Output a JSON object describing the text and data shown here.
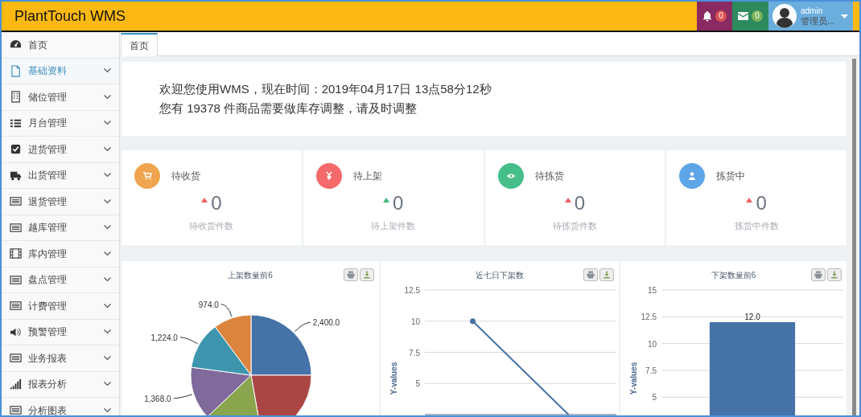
{
  "header": {
    "title": "PlantTouch WMS",
    "notifications": {
      "count": "0"
    },
    "messages": {
      "count": "0"
    },
    "user": {
      "name": "admin",
      "role": "管理员..."
    }
  },
  "sidebar": {
    "items": [
      {
        "label": "首页",
        "selected": false,
        "expandable": false
      },
      {
        "label": "基础资料",
        "selected": true,
        "expandable": true
      },
      {
        "label": "储位管理",
        "selected": false,
        "expandable": true
      },
      {
        "label": "月台管理",
        "selected": false,
        "expandable": true
      },
      {
        "label": "进货管理",
        "selected": false,
        "expandable": true
      },
      {
        "label": "出货管理",
        "selected": false,
        "expandable": true
      },
      {
        "label": "退货管理",
        "selected": false,
        "expandable": true
      },
      {
        "label": "越库管理",
        "selected": false,
        "expandable": true
      },
      {
        "label": "库内管理",
        "selected": false,
        "expandable": true
      },
      {
        "label": "盘点管理",
        "selected": false,
        "expandable": true
      },
      {
        "label": "计费管理",
        "selected": false,
        "expandable": true
      },
      {
        "label": "预警管理",
        "selected": false,
        "expandable": true
      },
      {
        "label": "业务报表",
        "selected": false,
        "expandable": true
      },
      {
        "label": "报表分析",
        "selected": false,
        "expandable": true
      },
      {
        "label": "分析图表",
        "selected": false,
        "expandable": true
      }
    ]
  },
  "tabs": [
    {
      "label": "首页",
      "selected": true
    }
  ],
  "welcome": {
    "lines": [
      "欢迎您使用WMS，现在时间：2019年04月17日 13点58分12秒",
      "您有 19378 件商品需要做库存调整，请及时调整"
    ]
  },
  "stats": [
    {
      "title": "待收货",
      "value": "0",
      "caption": "待收货件数",
      "color": "#f0a44f",
      "kind": "warning"
    },
    {
      "title": "待上架",
      "value": "0",
      "caption": "待上架件数",
      "color": "#f46a6a",
      "kind": "normal"
    },
    {
      "title": "待拣货",
      "value": "0",
      "caption": "待拣货件数",
      "color": "#45be89",
      "kind": "warning"
    },
    {
      "title": "拣货中",
      "value": "0",
      "caption": "拣货中件数",
      "color": "#5da4e8",
      "kind": "warning"
    }
  ],
  "charts": [
    {
      "chart_data": {
        "type": "pie",
        "title": "上架数量前6",
        "values": [
          2400,
          2134,
          1500,
          1368,
          1224,
          974
        ],
        "value_labels": [
          "2,400.0",
          null,
          null,
          "1,368.0",
          "1,224.0",
          "974.0"
        ]
      }
    },
    {
      "chart_data": {
        "type": "line",
        "title": "近七日下架数",
        "ylabel": "Y-values",
        "categories": [
          null,
          null
        ],
        "series": [
          {
            "color": "#4572a7",
            "values": [
              10,
              2.5
            ]
          }
        ],
        "ylim": [
          2.5,
          12.5
        ],
        "yticks": [
          5,
          7.5,
          10,
          12.5
        ],
        "grid": true
      }
    },
    {
      "chart_data": {
        "type": "bar",
        "title": "下架数量前6",
        "ylabel": "Y-values",
        "categories": [
          null
        ],
        "values": [
          12
        ],
        "grid": true,
        "ylim": [
          3,
          15
        ],
        "yticks": [
          5,
          7.5,
          10,
          12.5,
          15
        ],
        "value_labels": [
          "12.0"
        ]
      }
    }
  ]
}
